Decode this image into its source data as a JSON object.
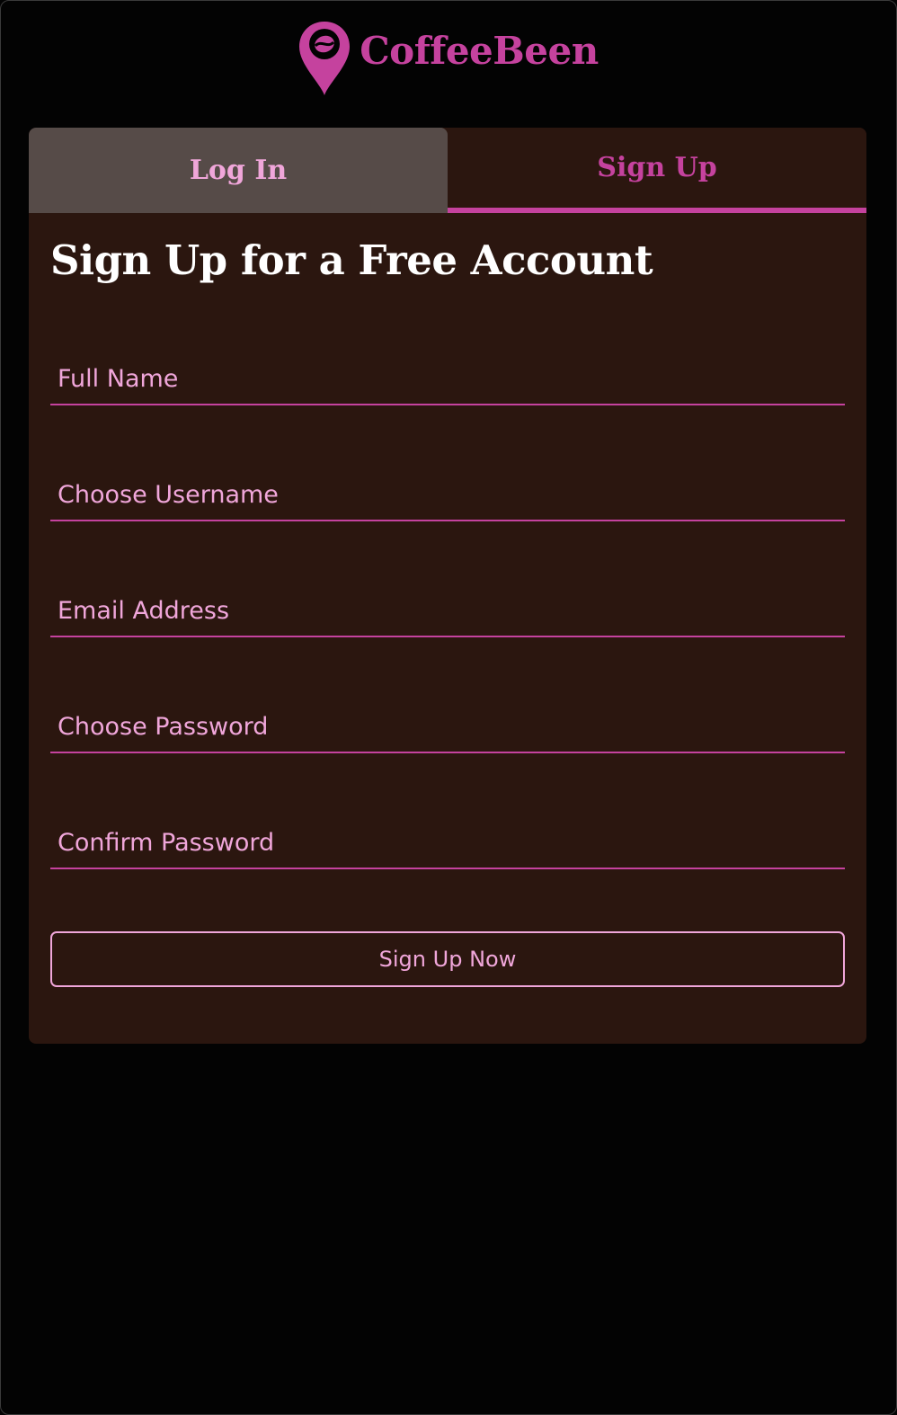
{
  "brand": {
    "name": "CoffeeBeen",
    "icon": "map-pin-coffee-bean-icon"
  },
  "tabs": [
    {
      "label": "Log In",
      "active": false
    },
    {
      "label": "Sign Up",
      "active": true
    }
  ],
  "form": {
    "heading": "Sign Up for a Free Account",
    "fields": [
      {
        "placeholder": "Full Name",
        "value": ""
      },
      {
        "placeholder": "Choose Username",
        "value": ""
      },
      {
        "placeholder": "Email Address",
        "value": ""
      },
      {
        "placeholder": "Choose Password",
        "value": ""
      },
      {
        "placeholder": "Confirm Password",
        "value": ""
      }
    ],
    "submit_label": "Sign Up Now"
  },
  "colors": {
    "page_background": "#030303",
    "card_background": "#2b160f",
    "inactive_tab_background": "#564b48",
    "accent": "#c5429e",
    "inactive_tab_text": "#f0a6da",
    "field_text": "#f0a6da",
    "heading_text": "#ffffff"
  }
}
